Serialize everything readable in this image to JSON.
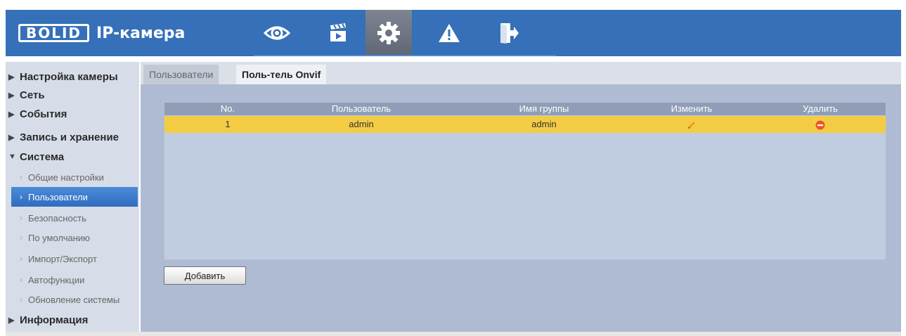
{
  "header": {
    "logo_text": "BOLID",
    "product": "IP-камера",
    "nav_icons": [
      "live-view-eye-icon",
      "playback-clapper-icon",
      "settings-gear-icon",
      "alarm-warning-icon",
      "logout-door-icon"
    ],
    "active_icon": "settings-gear-icon"
  },
  "sidebar": {
    "sections": [
      {
        "label": "Настройка камеры",
        "expanded": false
      },
      {
        "label": "Сеть",
        "expanded": false
      },
      {
        "label": "События",
        "expanded": false
      },
      {
        "label": "Запись и хранение",
        "expanded": false
      },
      {
        "label": "Система",
        "expanded": true
      }
    ],
    "system_items": [
      "Общие настройки",
      "Пользователи",
      "Безопасность",
      "По умолчанию",
      "Импорт/Экспорт",
      "Автофункции",
      "Обновление системы"
    ],
    "active_item": "Пользователи",
    "info_section": "Информация"
  },
  "tabs": {
    "users": "Пользователи",
    "onvif": "Поль-тель Onvif",
    "active": "Поль-тель Onvif"
  },
  "table": {
    "columns": [
      "No.",
      "Пользователь",
      "Имя группы",
      "Изменить",
      "Удалить"
    ],
    "rows": [
      {
        "no": "1",
        "user": "admin",
        "group": "admin",
        "edit_icon": "pencil-icon",
        "delete_icon": "delete-minus-icon"
      }
    ]
  },
  "add_button": "Добавить",
  "colors": {
    "header": "#3570b9",
    "selected_row": "#f4cc44",
    "content_bg": "#aebbd3",
    "table_bg": "#c0cce0",
    "delete_icon": "#f0542a",
    "active_sidebar": "#3a78cc"
  }
}
